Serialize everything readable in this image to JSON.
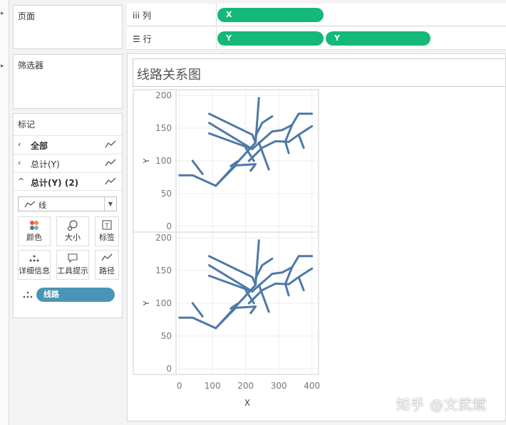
{
  "cards": {
    "pages": {
      "title": "页面"
    },
    "filters": {
      "title": "筛选器"
    },
    "marks": {
      "title": "标记",
      "rows": [
        {
          "chev": "‹",
          "label": "全部",
          "bold": true
        },
        {
          "chev": "‹",
          "label": "总计(Y)",
          "bold": false
        },
        {
          "chev": "^",
          "label": "总计(Y) (2)",
          "bold": true
        }
      ],
      "mark_type": "线",
      "buttons": [
        {
          "label": "颜色",
          "icon": "color-icon"
        },
        {
          "label": "大小",
          "icon": "size-icon"
        },
        {
          "label": "标签",
          "icon": "label-icon"
        },
        {
          "label": "详细信息",
          "icon": "detail-icon"
        },
        {
          "label": "工具提示",
          "icon": "tooltip-icon"
        },
        {
          "label": "路径",
          "icon": "path-icon"
        }
      ],
      "field_pill": "线路"
    }
  },
  "shelves": {
    "columns": {
      "icon": "iii",
      "label": "列",
      "pills": [
        "X"
      ]
    },
    "rows": {
      "icon": "☰",
      "label": "行",
      "pills": [
        "Y",
        "Y"
      ]
    }
  },
  "colors": {
    "pill_green": "#14b878",
    "pill_teal": "#4a95b6",
    "line": "#4e79a7"
  },
  "watermark": "知乎 @文武斌",
  "chart_data": {
    "type": "line",
    "title": "线路关系图",
    "xlabel": "X",
    "ylabel": "Y",
    "xlim": [
      -10,
      420
    ],
    "ylim": [
      0,
      200
    ],
    "x_ticks": [
      0,
      100,
      200,
      300,
      400
    ],
    "y_ticks": [
      0,
      50,
      100,
      150,
      200
    ],
    "panels": 2,
    "series": [
      {
        "x": [
          0,
          40,
          110,
          230,
          240
        ],
        "y": [
          78,
          78,
          62,
          128,
          196
        ]
      },
      {
        "x": [
          110,
          170,
          230,
          215
        ],
        "y": [
          62,
          93,
          95,
          85
        ]
      },
      {
        "x": [
          40,
          70
        ],
        "y": [
          100,
          80
        ]
      },
      {
        "x": [
          210,
          250,
          290,
          330,
          360,
          400
        ],
        "y": [
          100,
          120,
          130,
          129,
          140,
          153
        ]
      },
      {
        "x": [
          240,
          270
        ],
        "y": [
          128,
          87
        ]
      },
      {
        "x": [
          230,
          250,
          280
        ],
        "y": [
          138,
          158,
          168
        ]
      },
      {
        "x": [
          90,
          220,
          230
        ],
        "y": [
          172,
          140,
          128
        ]
      },
      {
        "x": [
          90,
          220
        ],
        "y": [
          158,
          118
        ]
      },
      {
        "x": [
          90,
          220
        ],
        "y": [
          142,
          118
        ]
      },
      {
        "x": [
          220,
          280,
          310,
          340,
          360
        ],
        "y": [
          118,
          145,
          147,
          155,
          172
        ]
      },
      {
        "x": [
          360,
          400
        ],
        "y": [
          172,
          172
        ]
      },
      {
        "x": [
          340,
          320
        ],
        "y": [
          155,
          130
        ]
      },
      {
        "x": [
          360,
          375
        ],
        "y": [
          140,
          120
        ]
      },
      {
        "x": [
          320,
          330
        ],
        "y": [
          129,
          112
        ]
      },
      {
        "x": [
          200,
          225
        ],
        "y": [
          120,
          100
        ]
      },
      {
        "x": [
          155,
          175
        ],
        "y": [
          92,
          99
        ]
      }
    ]
  }
}
